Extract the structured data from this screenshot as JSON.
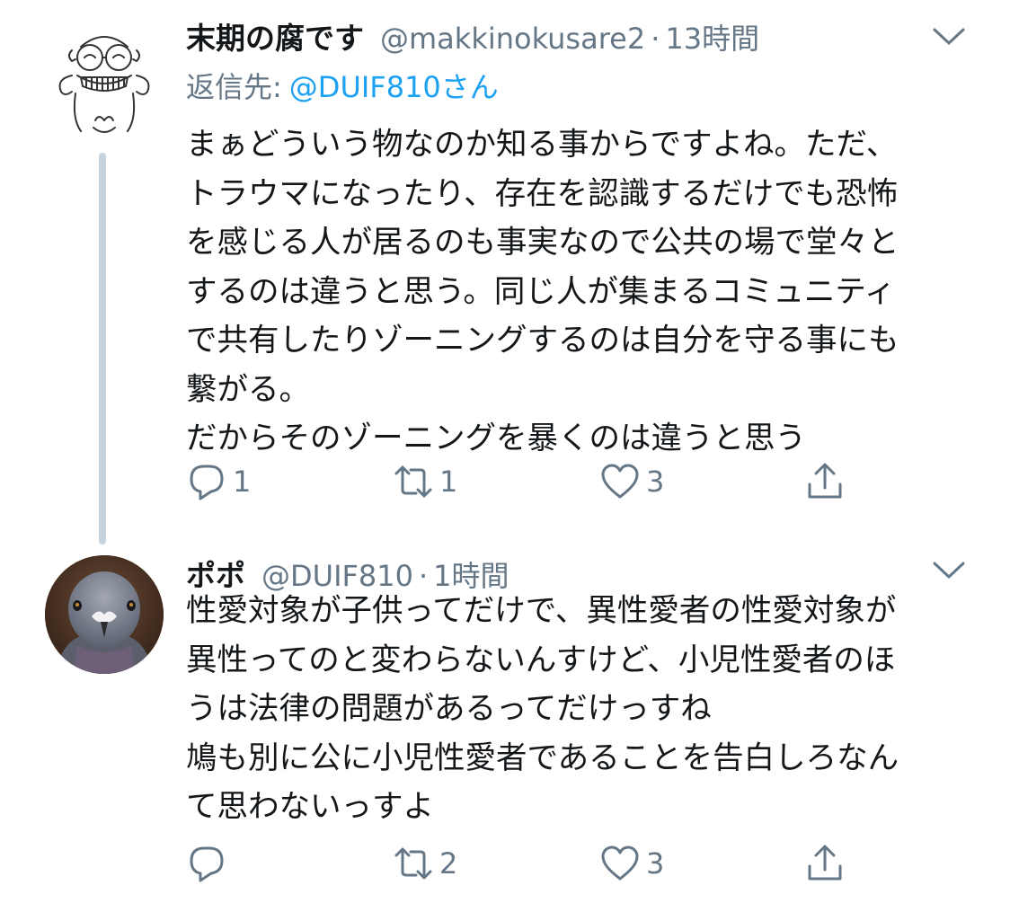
{
  "colors": {
    "text_primary": "#14171a",
    "text_secondary": "#657786",
    "link": "#1da1f2",
    "thread_line": "#c7d3dc",
    "icon": "#657786"
  },
  "tweets": [
    {
      "display_name": "末期の腐です",
      "handle": "@makkinokusare2",
      "dot": "·",
      "time": "13時間",
      "reply_to_label": "返信先:",
      "reply_to_mention": "@DUIF810さん",
      "body_lines": [
        "まぁどういう物なのか知る事からですよね。ただ、",
        "トラウマになったり、存在を認識するだけでも恐怖",
        "を感じる人が居るのも事実なので公共の場で堂々と",
        "するのは違うと思う。同じ人が集まるコミュニティ",
        "で共有したりゾーニングするのは自分を守る事にも",
        "繋がる。",
        "だからそのゾーニングを暴くのは違うと思う"
      ],
      "reply_count": "1",
      "retweet_count": "1",
      "like_count": "3",
      "icons": {
        "avatar": "sketch-character-avatar",
        "caret": "chevron-down-icon",
        "reply": "reply-bubble-icon",
        "retweet": "retweet-icon",
        "like": "heart-icon",
        "share": "share-icon"
      }
    },
    {
      "display_name": "ポポ",
      "handle": "@DUIF810",
      "dot": "·",
      "time": "1時間",
      "body_lines": [
        "性愛対象が子供ってだけで、異性愛者の性愛対象が",
        "異性ってのと変わらないんすけど、小児性愛者のほ",
        "うは法律の問題があるってだけっすね",
        "鳩も別に公に小児性愛者であることを告白しろなん",
        "て思わないっすよ"
      ],
      "reply_count": "",
      "retweet_count": "2",
      "like_count": "3",
      "icons": {
        "avatar": "pigeon-photo-avatar",
        "caret": "chevron-down-icon",
        "reply": "reply-bubble-icon",
        "retweet": "retweet-icon",
        "like": "heart-icon",
        "share": "share-icon"
      }
    }
  ]
}
